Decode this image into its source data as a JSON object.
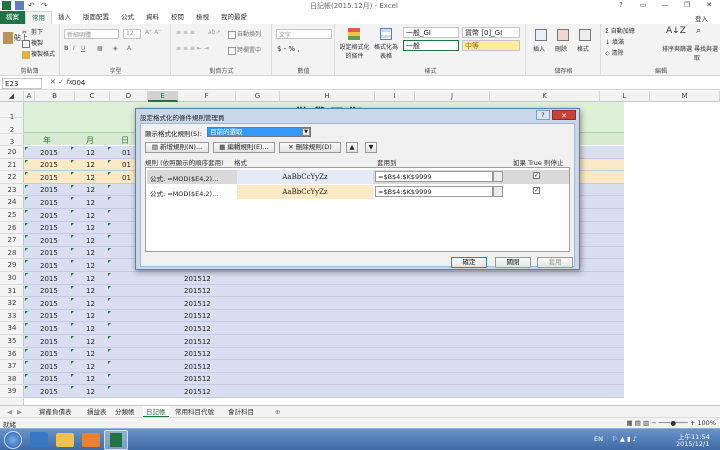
{
  "window": {
    "title": "日記帳(2015.12月) - Excel",
    "user": "登入"
  },
  "tabs": [
    "檔案",
    "常用",
    "插入",
    "版面配置",
    "公式",
    "資料",
    "校閱",
    "檢視",
    "我的最愛"
  ],
  "ribbon": {
    "clipboard": {
      "label": "剪貼簿",
      "cut": "剪下",
      "copy": "複製",
      "paste": "貼上",
      "painter": "複製格式"
    },
    "font": {
      "label": "字型",
      "name": "新細明體",
      "size": "12"
    },
    "align": {
      "label": "對齊方式",
      "wrap": "自動換列",
      "merge": "跨欄置中"
    },
    "number": {
      "label": "數值",
      "format": "文字",
      "sym": "$ - % ,"
    },
    "styles": {
      "label": "樣式",
      "cond": "設定格式化的條件",
      "table": "格式化為表格",
      "s1": "一般_GI",
      "s2": "貨幣 [0]_GI",
      "s3": "一般",
      "s4": "中等"
    },
    "cells": {
      "label": "儲存格",
      "insert": "插入",
      "delete": "刪除",
      "format": "格式"
    },
    "editing": {
      "label": "編輯",
      "autosum": "自動加總",
      "fill": "填滿",
      "clear": "清除",
      "sort": "排序與篩選",
      "find": "尋找與選取"
    }
  },
  "formula": {
    "namebox": "E23",
    "fx": "fx",
    "value": "004"
  },
  "columns": [
    "A",
    "B",
    "C",
    "D",
    "E",
    "F",
    "G",
    "H",
    "I",
    "J",
    "K",
    "L",
    "M"
  ],
  "grid": {
    "big_title": "借貸平衡",
    "header_row": {
      "year": "年",
      "month": "月",
      "day": "日"
    },
    "top_rows": [
      {
        "r": "20",
        "y": "2015",
        "m": "12",
        "d": "01"
      },
      {
        "r": "21",
        "y": "2015",
        "m": "12",
        "d": "01"
      },
      {
        "r": "22",
        "y": "2015",
        "m": "12",
        "d": "01"
      },
      {
        "r": "23",
        "y": "2015",
        "m": "12",
        "d": ""
      },
      {
        "r": "24",
        "y": "2015",
        "m": "12",
        "d": ""
      },
      {
        "r": "25",
        "y": "2015",
        "m": "12",
        "d": ""
      },
      {
        "r": "26",
        "y": "2015",
        "m": "12",
        "d": ""
      },
      {
        "r": "27",
        "y": "2015",
        "m": "12",
        "d": ""
      }
    ],
    "lower_rows": [
      "28",
      "29",
      "30",
      "31",
      "32",
      "33",
      "34",
      "35",
      "36",
      "37",
      "38",
      "39"
    ],
    "year": "2015",
    "month": "12",
    "ym": "201512",
    "row_labels_top": [
      "1",
      "2",
      "3"
    ]
  },
  "dialog": {
    "title": "設定格式化的條件規則管理員",
    "show_label": "顯示格式化規則(S):",
    "show_value": "目前的選取",
    "new": "新增規則(N)...",
    "edit": "編輯規則(E)...",
    "del": "刪除規則(D)",
    "col_rule": "規則 (依照顯示的順序套用)",
    "col_format": "格式",
    "col_applies": "套用到",
    "col_stop": "如果 True 則停止",
    "rules": [
      {
        "rule": "公式: =MOD($E4,2)...",
        "preview": "AaBbCcYyZz",
        "applies": "=$B$4:$K$9999",
        "fill": "#e6eaf6"
      },
      {
        "rule": "公式: =MOD($E4,2)...",
        "preview": "AaBbCcYyZz",
        "applies": "=$B$4:$K$9999",
        "fill": "#fce9c6"
      }
    ],
    "ok": "確定",
    "close": "關閉",
    "apply": "套用",
    "check": "✓"
  },
  "sheets": [
    "資產負債表",
    "損益表",
    "分類帳",
    "日記帳",
    "常用科目代號",
    "會計科目"
  ],
  "status": {
    "left": "就緒",
    "zoom": "100%"
  },
  "taskbar": {
    "lang": "EN",
    "time": "上午11:54",
    "date": "2015/12/1"
  }
}
